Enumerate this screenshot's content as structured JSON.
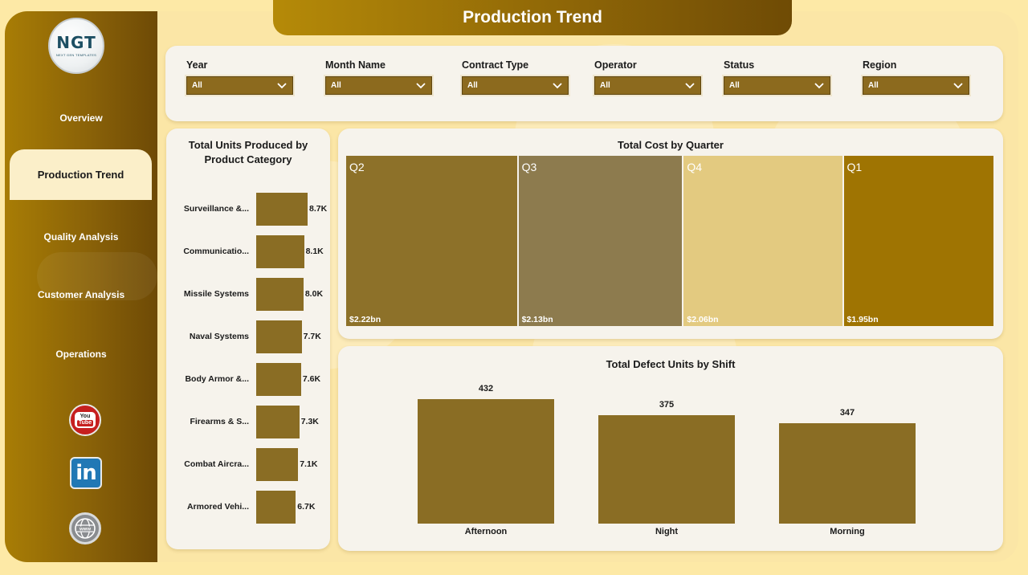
{
  "page": {
    "title": "Production Trend"
  },
  "logo": {
    "text": "NGT",
    "subtext": "NEXT GEN TEMPLATES"
  },
  "nav": [
    {
      "label": "Overview",
      "active": false
    },
    {
      "label": "Production Trend",
      "active": true
    },
    {
      "label": "Quality Analysis",
      "active": false
    },
    {
      "label": "Customer Analysis",
      "active": false
    },
    {
      "label": "Operations",
      "active": false
    }
  ],
  "social": [
    {
      "icon": "youtube-icon",
      "text1": "You",
      "text2": "Tube"
    },
    {
      "icon": "linkedin-icon",
      "text": "in"
    },
    {
      "icon": "globe-icon",
      "text": "www"
    }
  ],
  "filters": [
    {
      "label": "Year",
      "value": "All"
    },
    {
      "label": "Month Name",
      "value": "All"
    },
    {
      "label": "Contract Type",
      "value": "All"
    },
    {
      "label": "Operator",
      "value": "All"
    },
    {
      "label": "Status",
      "value": "All"
    },
    {
      "label": "Region",
      "value": "All"
    }
  ],
  "colors": {
    "sidebar": "#8a6208",
    "accent_bar": "#8a6d24",
    "panel": "#f6f3ec",
    "background": "#fde9a6"
  },
  "chart_data": [
    {
      "type": "bar",
      "orientation": "horizontal",
      "title": "Total Units Produced by Product Category",
      "categories": [
        "Surveillance &...",
        "Communicatio...",
        "Missile Systems",
        "Naval Systems",
        "Body Armor &...",
        "Firearms & S...",
        "Combat Aircra...",
        "Armored Vehi..."
      ],
      "values": [
        8700,
        8100,
        8000,
        7700,
        7600,
        7300,
        7100,
        6700
      ],
      "value_labels": [
        "8.7K",
        "8.1K",
        "8.0K",
        "7.7K",
        "7.6K",
        "7.3K",
        "7.1K",
        "6.7K"
      ],
      "color": "#8a6d24"
    },
    {
      "type": "treemap",
      "title": "Total Cost by Quarter",
      "categories": [
        "Q2",
        "Q3",
        "Q4",
        "Q1"
      ],
      "values": [
        2.22,
        2.13,
        2.06,
        1.95
      ],
      "unit": "bn",
      "value_labels": [
        "$2.22bn",
        "$2.13bn",
        "$2.06bn",
        "$1.95bn"
      ],
      "colors": [
        "#8d7129",
        "#8d7b4e",
        "#e3ca80",
        "#9f7402"
      ]
    },
    {
      "type": "bar",
      "orientation": "vertical",
      "title": "Total Defect Units by Shift",
      "categories": [
        "Afternoon",
        "Night",
        "Morning"
      ],
      "values": [
        432,
        375,
        347
      ],
      "ylim": [
        0,
        432
      ],
      "color": "#8a6d24"
    }
  ]
}
